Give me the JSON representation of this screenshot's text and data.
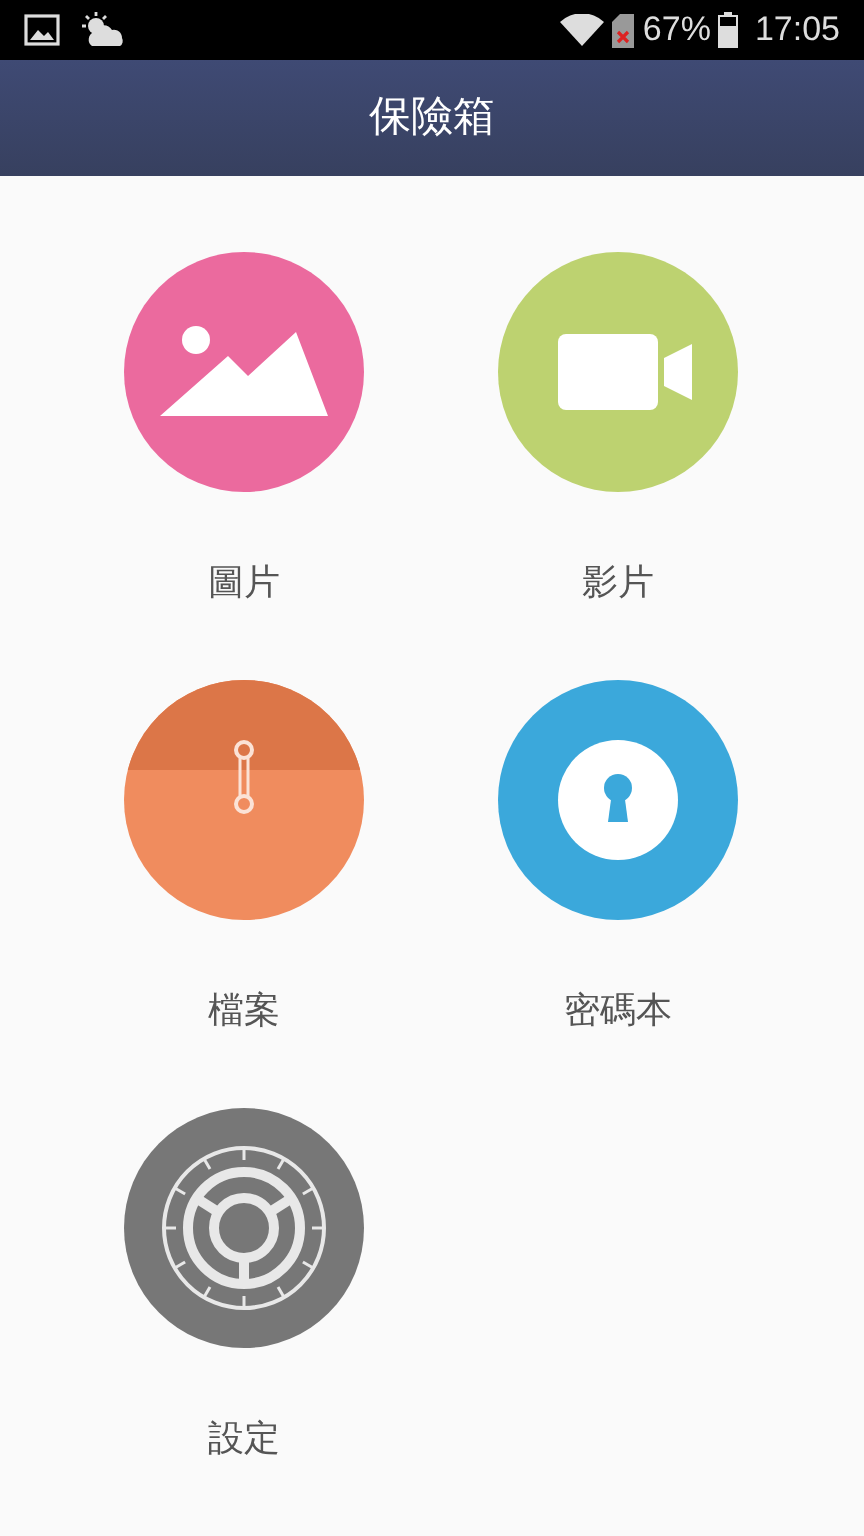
{
  "status_bar": {
    "battery_percent": "67%",
    "time": "17:05"
  },
  "header": {
    "title": "保險箱"
  },
  "items": [
    {
      "kind": "pictures",
      "label": "圖片"
    },
    {
      "kind": "videos",
      "label": "影片"
    },
    {
      "kind": "files",
      "label": "檔案"
    },
    {
      "kind": "passwords",
      "label": "密碼本"
    },
    {
      "kind": "settings",
      "label": "設定"
    }
  ]
}
